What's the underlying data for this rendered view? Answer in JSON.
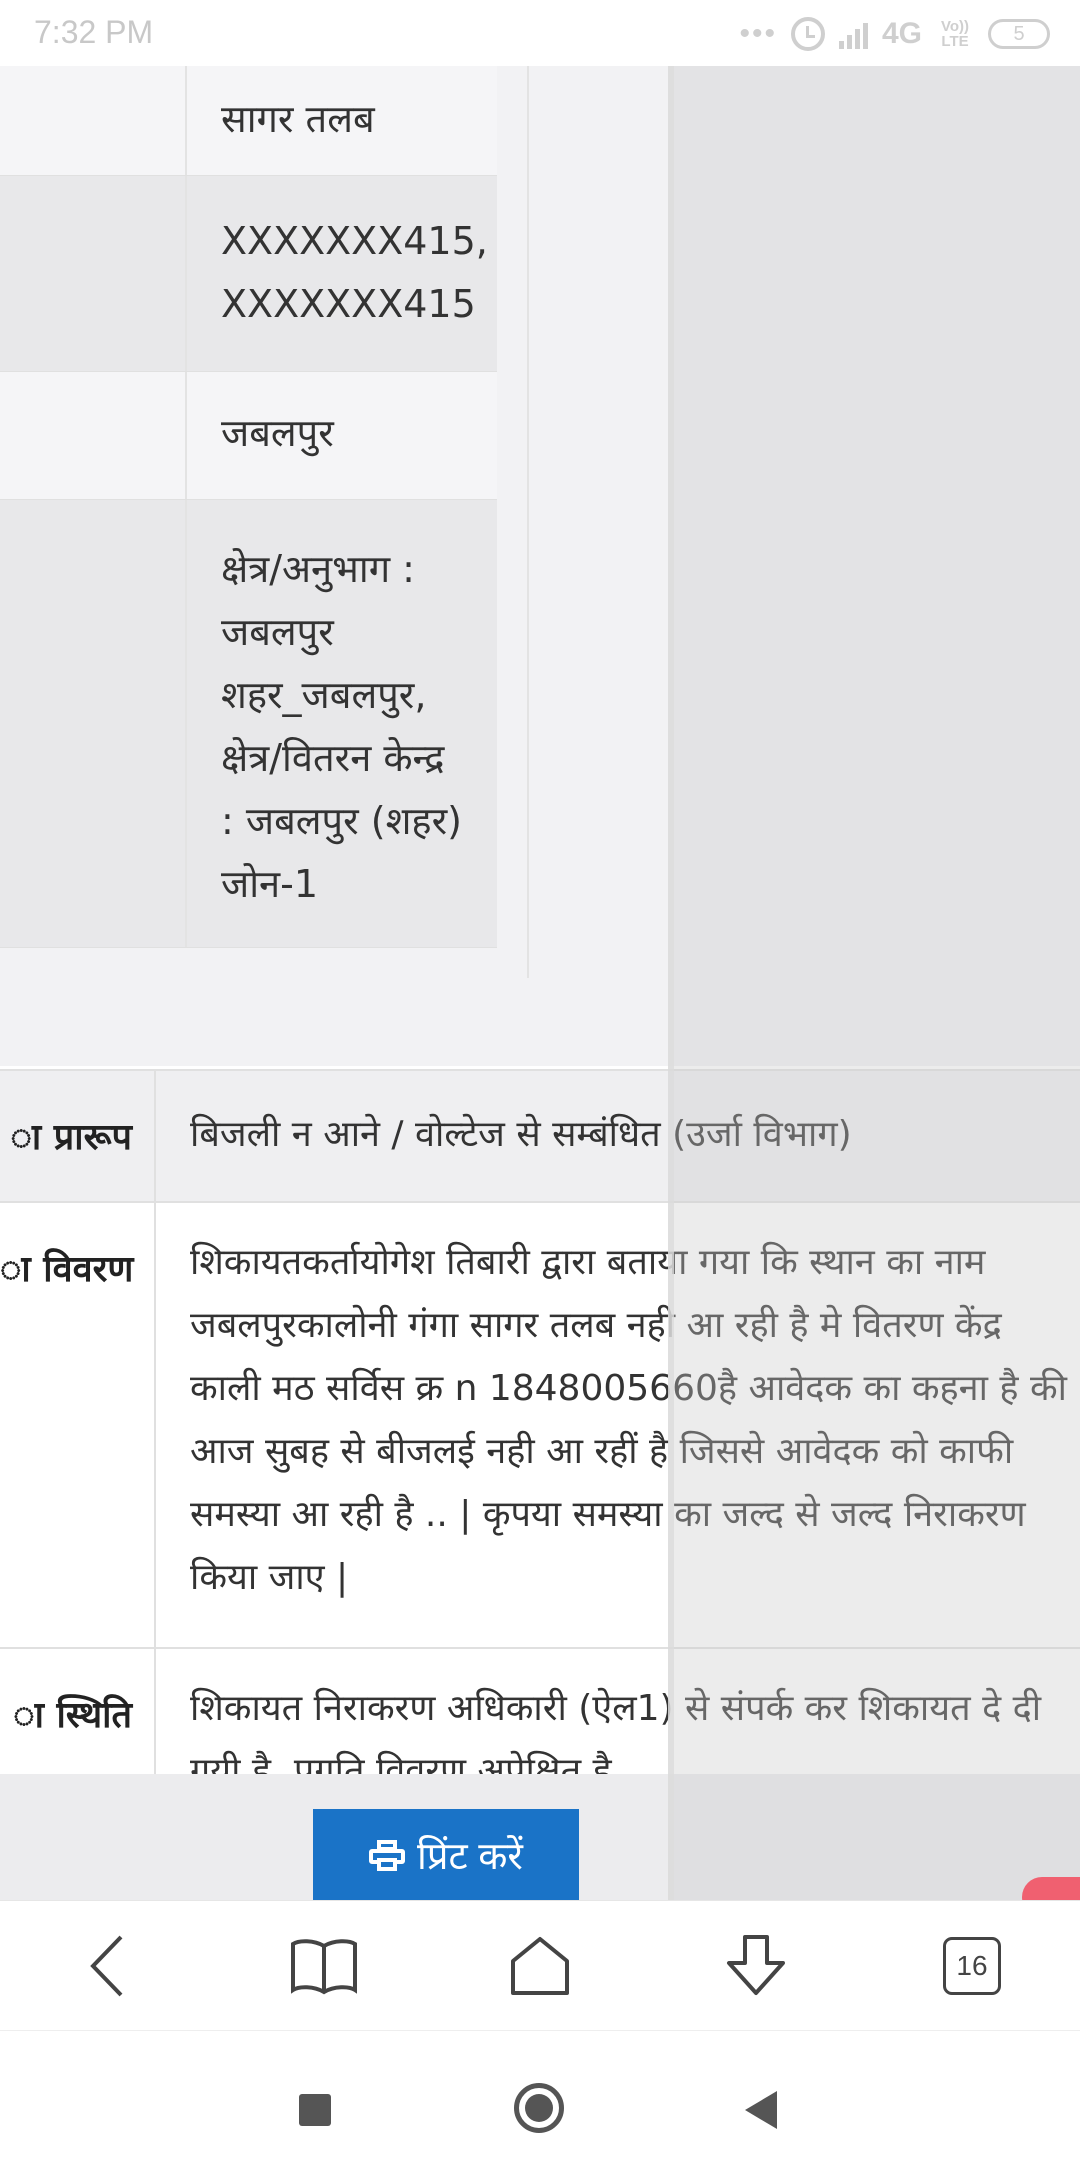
{
  "status_bar": {
    "time": "7:32 PM",
    "network": "4G",
    "volte": "Vo)) LTE",
    "battery": "5"
  },
  "details_table": {
    "rows": [
      {
        "value": "सागर तलब"
      },
      {
        "value": "XXXXXXX415,\nXXXXXXX415"
      },
      {
        "value": "जबलपुर"
      },
      {
        "value": "क्षेत्र/अनुभाग :\nजबलपुर\nशहर_जबलपुर,\nक्षेत्र/वितरन केन्द्र\n: जबलपुर (शहर)\nजोन-1"
      }
    ]
  },
  "complaint_table": {
    "rows": [
      {
        "label": "ा प्रारूप",
        "value": "बिजली न आने / वोल्टेज से सम्बंधित (उर्जा विभाग)"
      },
      {
        "label": "ा विवरण",
        "value": "शिकायतकर्तायोगेश तिबारी द्वारा बताया गया कि स्थान का नाम जबलपुरकालोनी गंगा सागर तलब नही आ रही है मे वितरण केंद्र काली मठ सर्विस क्र n 1848005660है आवेदक का कहना है की आज सुबह से बीजलई नही आ रहीं है जिससे आवेदक को काफी समस्या आ रही है .. | कृपया समस्या का जल्द से जल्द निराकरण किया जाए |"
      },
      {
        "label": "ा स्थिति",
        "value": "शिकायत निराकरण अधिकारी (ऐल1) से संपर्क कर शिकायत दे दी गयी है ,प्रगति विवरण अपेक्षित है"
      }
    ]
  },
  "print_button": {
    "label": "प्रिंट करें",
    "icon": "printer-icon",
    "color": "#1a73c7"
  },
  "browser_toolbar": {
    "tab_count": "16",
    "icons": [
      "back-icon",
      "bookmarks-icon",
      "home-icon",
      "download-icon",
      "tabs-icon"
    ]
  },
  "system_nav": {
    "icons": [
      "recent-apps-icon",
      "home-circle-icon",
      "back-triangle-icon"
    ]
  }
}
